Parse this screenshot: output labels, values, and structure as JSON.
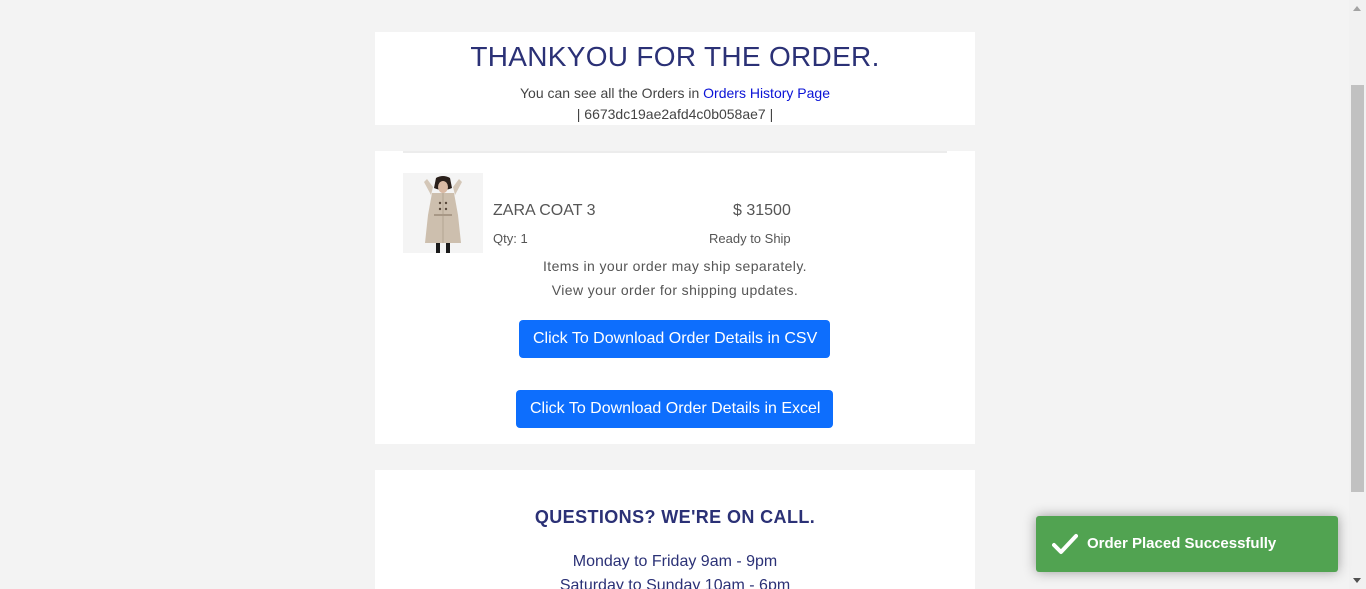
{
  "header": {
    "title": "THANKYOU FOR THE ORDER.",
    "subtitle_prefix": "You can see all the Orders in",
    "orders_history_link": "Orders History Page",
    "order_id_text": "| 6673dc19ae2afd4c0b058ae7 |"
  },
  "order_item": {
    "image_icon": "zara-coat-product-photo",
    "name": "ZARA COAT 3",
    "price": "$ 31500",
    "qty": "Qty: 1",
    "status": "Ready to Ship"
  },
  "shipping": {
    "line1": "Items in your order may ship separately.",
    "line2": "View your order for shipping updates."
  },
  "buttons": {
    "csv_label": "Click To Download Order Details in CSV",
    "excel_label": "Click To Download Order Details in Excel",
    "color": "#0d6efd"
  },
  "support": {
    "title": "QUESTIONS? WE'RE ON CALL.",
    "hours_weekday": "Monday to Friday 9am - 9pm",
    "hours_weekend": "Saturday to Sunday 10am - 6pm"
  },
  "toast": {
    "icon": "checkmark-icon",
    "message": "Order Placed Successfully",
    "color": "#51a351"
  }
}
